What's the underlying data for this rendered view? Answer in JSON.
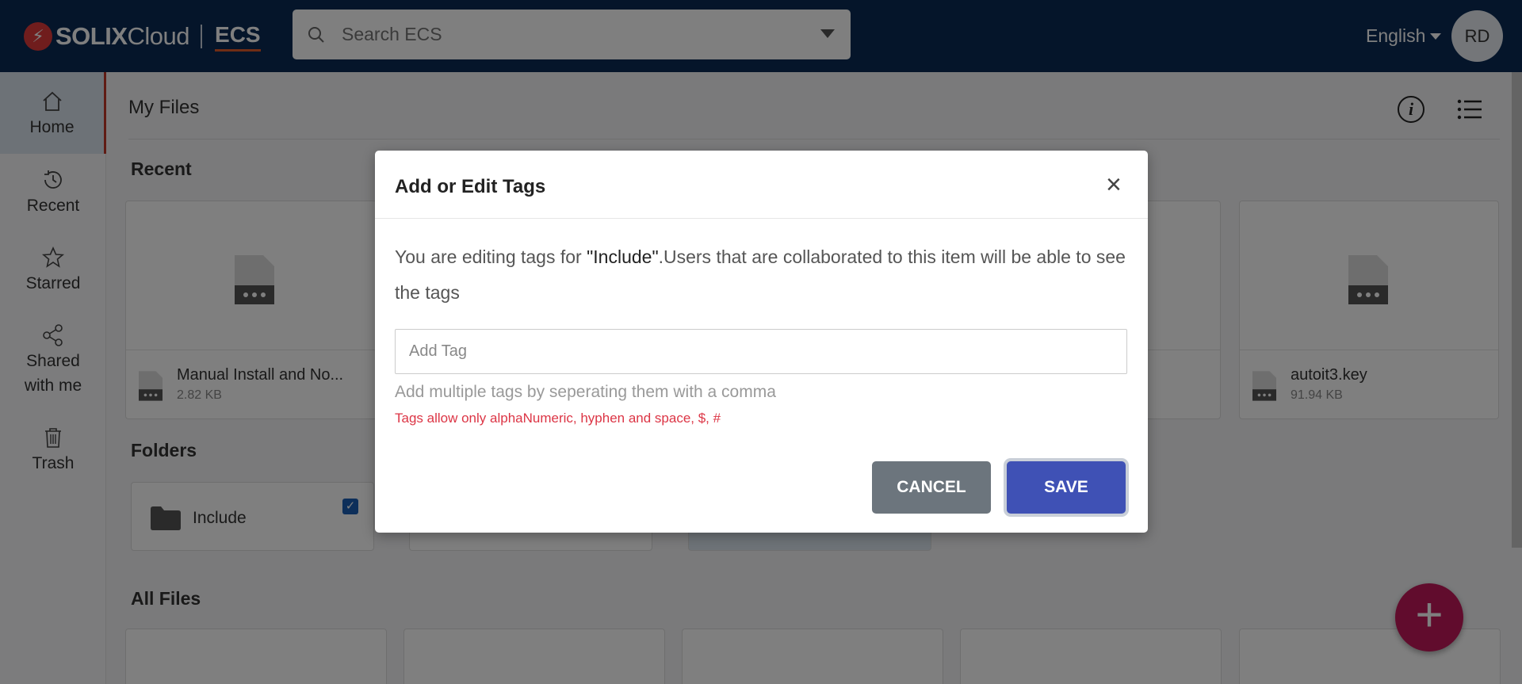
{
  "header": {
    "logo_brand": "SOLIX",
    "logo_cloud": "Cloud",
    "logo_product": "ECS",
    "search_placeholder": "Search ECS",
    "language": "English",
    "avatar_initials": "RD"
  },
  "sidebar": {
    "items": [
      {
        "label": "Home",
        "icon": "home-icon",
        "active": true
      },
      {
        "label": "Recent",
        "icon": "clock-icon"
      },
      {
        "label": "Starred",
        "icon": "star-icon"
      },
      {
        "label": "Shared with me",
        "label_line1": "Shared",
        "label_line2": "with me",
        "icon": "share-icon"
      },
      {
        "label": "Trash",
        "icon": "trash-icon"
      }
    ]
  },
  "main": {
    "title": "My Files",
    "sections": {
      "recent": "Recent",
      "folders": "Folders",
      "all_files": "All Files"
    },
    "recent_files": [
      {
        "name": "Manual Install and No...",
        "size": "2.82 KB"
      },
      {
        "name": "autoit3.key",
        "size": "91.94 KB"
      }
    ],
    "folders": [
      {
        "name": "Include",
        "checked": true
      }
    ]
  },
  "modal": {
    "title": "Add or Edit Tags",
    "close": "×",
    "desc_prefix": "You are editing tags for ",
    "desc_item": "\"Include\"",
    "desc_suffix": ".Users that are collaborated to this item will be able to see the tags",
    "input_placeholder": "Add Tag",
    "hint": "Add multiple tags by seperating them with a comma",
    "error": "Tags allow only alphaNumeric, hyphen and space, $, #",
    "cancel_label": "CANCEL",
    "save_label": "SAVE"
  },
  "fab_label": "+",
  "colors": {
    "header_bg": "#0a2a55",
    "save_button": "#3f51b5",
    "cancel_button": "#6c757d",
    "error_text": "#dc3545",
    "fab": "#c2185b"
  }
}
